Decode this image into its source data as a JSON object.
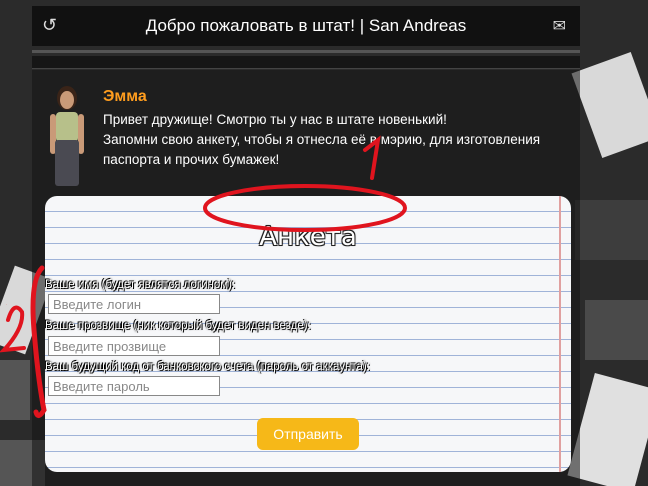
{
  "header": {
    "title": "Добро пожаловать в штат! | San Andreas",
    "refresh_icon": "↺",
    "mail_icon": "✉"
  },
  "npc": {
    "name": "Эмма",
    "lines": [
      "Привет дружище! Смотрю ты у нас в штате новенький!",
      "Запомни свою анкету, чтобы я отнесла её в мэрию, для изготовления паспорта и прочих бумажек!"
    ]
  },
  "form": {
    "title": "Анкета",
    "fields": [
      {
        "label": "Ваше имя (будет являтся логином):",
        "placeholder": "Введите логин"
      },
      {
        "label": "Ваше прозвище (ник который будет виден везде):",
        "placeholder": "Введите прозвище"
      },
      {
        "label": "Ваш будущий код от банковского счета (пароль от аккаунта):",
        "placeholder": "Введите пароль"
      }
    ],
    "submit_label": "Отправить"
  },
  "annotations": {
    "one": "1",
    "two": "2"
  },
  "colors": {
    "npc_name": "#ff9d1e",
    "submit": "#f6b818",
    "annotation": "#e0141e"
  }
}
